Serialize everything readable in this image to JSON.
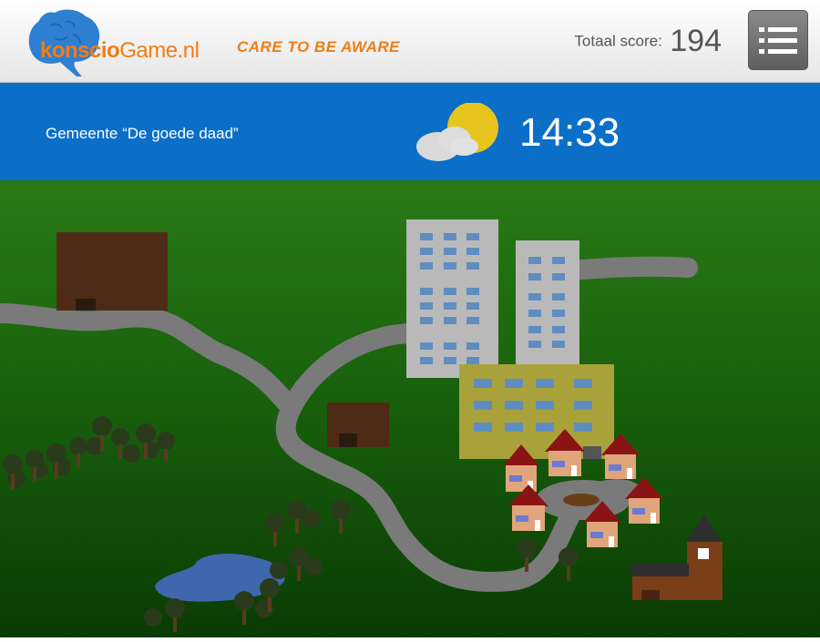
{
  "header": {
    "logo_text_bold": "konscio",
    "logo_text_rest": "Game.nl",
    "tagline": "CARE TO BE AWARE",
    "score_label": "Totaal score:",
    "score_value": "194",
    "menu_icon": "hamburger-menu-icon"
  },
  "status_bar": {
    "municipality": "Gemeente “De goede daad”",
    "weather_icon": "partly-sunny-icon",
    "time": "14:33"
  },
  "colors": {
    "accent_orange": "#ef7d16",
    "status_blue": "#0b6fc8",
    "grass_dark": "#0a3d06",
    "grass_light": "#2a7d18",
    "road": "#7a7a7a"
  }
}
